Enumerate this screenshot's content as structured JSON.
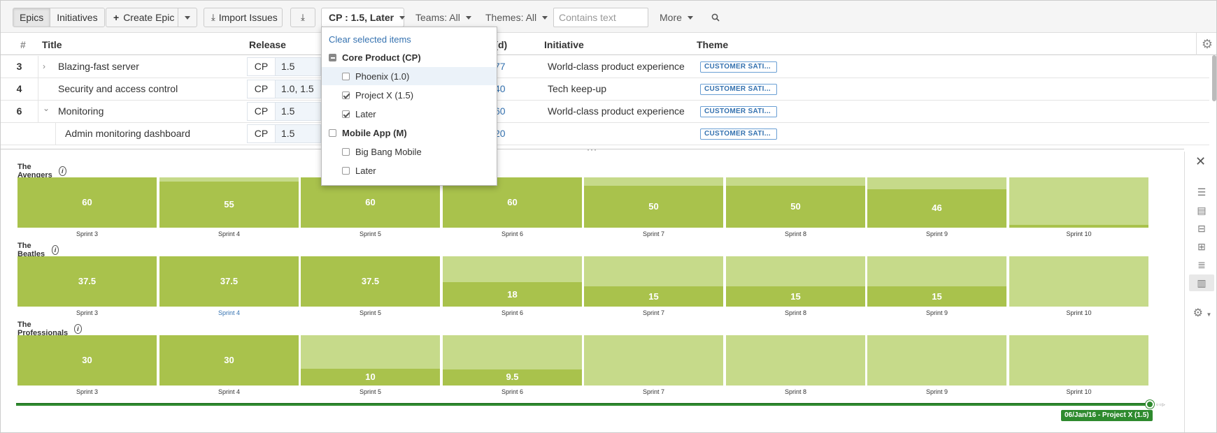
{
  "toolbar": {
    "view_tabs": [
      "Epics",
      "Initiatives"
    ],
    "create_epic": "Create Epic",
    "import_issues": "Import Issues",
    "release_filter": "CP : 1.5, Later",
    "teams_filter": "Teams: All",
    "themes_filter": "Themes: All",
    "search_placeholder": "Contains text",
    "more": "More"
  },
  "table": {
    "headers": {
      "num": "#",
      "title": "Title",
      "release": "Release",
      "estimate": "te (d)",
      "initiative": "Initiative",
      "theme": "Theme"
    },
    "rows": [
      {
        "num": "3",
        "expander": "›",
        "title": "Blazing-fast server",
        "rel_code": "CP",
        "rel_ver": "1.5",
        "estimate": "77",
        "initiative": "World-class product experience",
        "theme": "CUSTOMER SATI..."
      },
      {
        "num": "4",
        "expander": "",
        "title": "Security and access control",
        "rel_code": "CP",
        "rel_ver": "1.0, 1.5",
        "estimate": "40",
        "initiative": "Tech keep-up",
        "theme": "CUSTOMER SATI..."
      },
      {
        "num": "6",
        "expander": "⌄",
        "title": "Monitoring",
        "rel_code": "CP",
        "rel_ver": "1.5",
        "estimate": "60",
        "initiative": "World-class product experience",
        "theme": "CUSTOMER SATI..."
      },
      {
        "num": "",
        "expander": "",
        "title": "Admin monitoring dashboard",
        "rel_code": "CP",
        "rel_ver": "1.5",
        "estimate": "20",
        "initiative": "",
        "theme": "CUSTOMER SATI..."
      }
    ]
  },
  "dropdown": {
    "clear": "Clear selected items",
    "items": [
      {
        "label": "Core Product (CP)",
        "group": true,
        "state": "partial"
      },
      {
        "label": "Phoenix (1.0)",
        "group": false,
        "state": "unchecked",
        "highlight": true
      },
      {
        "label": "Project X (1.5)",
        "group": false,
        "state": "checked"
      },
      {
        "label": "Later",
        "group": false,
        "state": "checked"
      },
      {
        "label": "Mobile App (M)",
        "group": true,
        "state": "unchecked"
      },
      {
        "label": "Big Bang Mobile",
        "group": false,
        "state": "unchecked"
      },
      {
        "label": "Later",
        "group": false,
        "state": "unchecked"
      }
    ]
  },
  "capacity": {
    "colors": {
      "capacity": "#c6da8a",
      "load": "#a9c24c"
    },
    "teams": [
      {
        "name": "The Avengers",
        "sprints": [
          {
            "label": "Sprint 3",
            "value": "60",
            "fill": 1.0
          },
          {
            "label": "Sprint 4",
            "value": "55",
            "fill": 0.92
          },
          {
            "label": "Sprint 5",
            "value": "60",
            "fill": 1.0
          },
          {
            "label": "Sprint 6",
            "value": "60",
            "fill": 1.0
          },
          {
            "label": "Sprint 7",
            "value": "50",
            "fill": 0.83
          },
          {
            "label": "Sprint 8",
            "value": "50",
            "fill": 0.83
          },
          {
            "label": "Sprint 9",
            "value": "46",
            "fill": 0.77
          },
          {
            "label": "Sprint 10",
            "value": "",
            "fill": 0.06
          }
        ]
      },
      {
        "name": "The Beatles",
        "sprints": [
          {
            "label": "Sprint 3",
            "value": "37.5",
            "fill": 1.0
          },
          {
            "label": "Sprint 4",
            "value": "37.5",
            "fill": 1.0,
            "link": true
          },
          {
            "label": "Sprint 5",
            "value": "37.5",
            "fill": 1.0
          },
          {
            "label": "Sprint 6",
            "value": "18",
            "fill": 0.48
          },
          {
            "label": "Sprint 7",
            "value": "15",
            "fill": 0.4
          },
          {
            "label": "Sprint 8",
            "value": "15",
            "fill": 0.4
          },
          {
            "label": "Sprint 9",
            "value": "15",
            "fill": 0.4
          },
          {
            "label": "Sprint 10",
            "value": "",
            "fill": 0.0
          }
        ]
      },
      {
        "name": "The Professionals",
        "sprints": [
          {
            "label": "Sprint 3",
            "value": "30",
            "fill": 1.0
          },
          {
            "label": "Sprint 4",
            "value": "30",
            "fill": 1.0
          },
          {
            "label": "Sprint 5",
            "value": "10",
            "fill": 0.33
          },
          {
            "label": "Sprint 6",
            "value": "9.5",
            "fill": 0.32
          },
          {
            "label": "Sprint 7",
            "value": "",
            "fill": 0.0
          },
          {
            "label": "Sprint 8",
            "value": "",
            "fill": 0.0
          },
          {
            "label": "Sprint 9",
            "value": "",
            "fill": 0.0
          },
          {
            "label": "Sprint 10",
            "value": "",
            "fill": 0.0
          }
        ]
      }
    ]
  },
  "timeline": {
    "badge": "06/Jan/16 - Project X (1.5)"
  },
  "sidepanel": {
    "icons": [
      "close-icon",
      "sliders-icon",
      "card-icon",
      "hierarchy-icon",
      "tree-icon",
      "list-icon",
      "columns-icon",
      "gear-icon"
    ]
  }
}
